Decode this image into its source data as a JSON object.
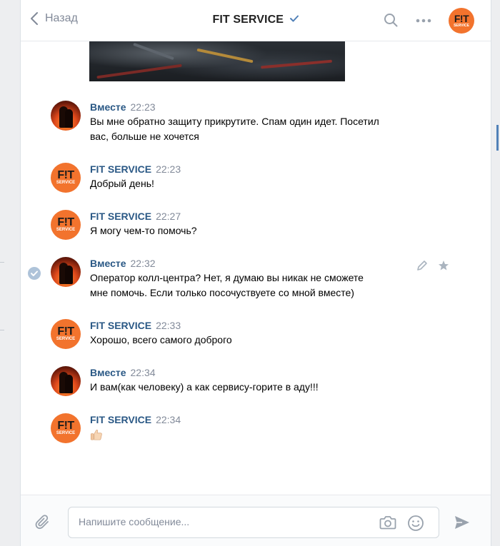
{
  "header": {
    "back_label": "Назад",
    "title": "FIT SERVICE",
    "logo_big": "F!T",
    "logo_small": "SERVICE"
  },
  "messages": [
    {
      "author": "Вместе",
      "time": "22:23",
      "lines": [
        "Вы мне обратно защиту прикрутите. Спам один идет. Посетил",
        "вас, больше не хочется"
      ]
    },
    {
      "author": "FIT SERVICE",
      "time": "22:23",
      "lines": [
        "Добрый день!"
      ]
    },
    {
      "author": "FIT SERVICE",
      "time": "22:27",
      "lines": [
        "Я могу чем-то помочь?"
      ]
    },
    {
      "author": "Вместе",
      "time": "22:32",
      "lines": [
        "Оператор колл-центра? Нет, я думаю вы никак не сможете",
        "мне помочь. Если только посочуствуете со мной вместе)"
      ]
    },
    {
      "author": "FIT SERVICE",
      "time": "22:33",
      "lines": [
        "Хорошо, всего самого доброго"
      ]
    },
    {
      "author": "Вместе",
      "time": "22:34",
      "lines": [
        "И вам(как человеку) а как сервису-горите в аду!!!"
      ]
    },
    {
      "author": "FIT SERVICE",
      "time": "22:34",
      "emoji": "thumbs-up-icon"
    }
  ],
  "composer": {
    "placeholder": "Напишите сообщение..."
  },
  "colors": {
    "accent": "#5181b8",
    "author": "#2a5885",
    "brand_orange": "#f2732d"
  }
}
